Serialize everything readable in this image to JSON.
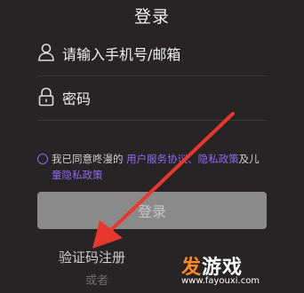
{
  "header": {
    "title": "登录"
  },
  "form": {
    "phone_label": "请输入手机号/邮箱",
    "password_label": "密码"
  },
  "agreement": {
    "prefix": "我已同意咚漫的 ",
    "link_service": "用户服务协议",
    "sep1": "、",
    "link_privacy": "隐私政策",
    "and": "及儿",
    "link_child_line2": "童隐私政策"
  },
  "actions": {
    "login_label": "登录",
    "code_register_label": "验证码注册",
    "or_label": "或者"
  },
  "watermark": {
    "brand": "游戏",
    "brand_accent": "发",
    "url": "www.fayouxi.com"
  },
  "colors": {
    "background": "#262424",
    "accent": "#8c6cf0",
    "arrow": "#e8382e",
    "watermark_accent": "#ff8a1f"
  },
  "icons": [
    "user-icon",
    "lock-icon",
    "radio-circle-icon",
    "arrow-annotation"
  ]
}
